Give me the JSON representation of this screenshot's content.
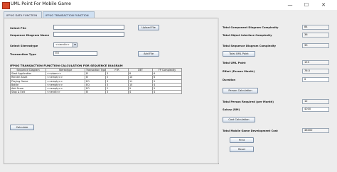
{
  "window": {
    "title": "UML Point For Mobile Game",
    "minimize": "—",
    "maximize": "☐",
    "close": "✕"
  },
  "tabs": [
    {
      "label": "IFPUG DATA FUNCTION"
    },
    {
      "label": "IFPUG TRANSACTION FUNCTION"
    }
  ],
  "form": {
    "select_file_label": "Select File",
    "select_file_value": "",
    "upload_file_label": "Upload File",
    "sequence_diagram_name_label": "Sequence Diagram Name",
    "sequence_diagram_name_value": "",
    "stereotype_label": "Select Stereotype",
    "stereotype_value": "<<endi>>",
    "transaction_type_label": "Transaction Type",
    "transaction_type_value": "EO",
    "add_file_label": "Add File"
  },
  "table": {
    "heading": "IFPUG TRANSACTION FUNCTION CALCULATION FOR SEQUENCE DIAGRAM",
    "columns": [
      "Sequence Diagram",
      "Stereotype",
      "Transaction Type",
      "FTR",
      "DET",
      "FP Complexity"
    ],
    "rows": [
      [
        "Start Application",
        "<<vtam>>",
        "EI",
        "3",
        "8",
        "6"
      ],
      [
        "Render Asset",
        "<<empty>>",
        "EI",
        "5",
        "10",
        "6"
      ],
      [
        "Playing Game",
        "<<empty>>",
        "EO",
        "3",
        "11",
        "5"
      ],
      [
        "Battle",
        "<<empty>>",
        "EQ",
        "3",
        "15",
        "4"
      ],
      [
        "Add Score",
        "<<empty>>",
        "EO",
        "2",
        "9",
        "5"
      ],
      [
        "Stop & Exit",
        "<<endi>>",
        "EI",
        "3",
        "4",
        "4"
      ]
    ]
  },
  "calculate_label": "Calculate",
  "summary": {
    "total_component_label": "Total Component Diagram Complexity",
    "total_component_value": "84",
    "total_object_label": "Total Object Interface Complexity",
    "total_object_value": "36",
    "total_sequence_label": "Total Sequence Diagram Complexity",
    "total_sequence_value": "33",
    "total_uml_button": "Total UML Point",
    "total_uml_label": "Total UML Point",
    "total_uml_value": "153",
    "effort_label": "Effort (Person Month)",
    "effort_value": "76.5",
    "duration_label": "Duration",
    "duration_value": "6",
    "person_calc_button": "Person Calculation",
    "total_person_label": "Total Person Required (per Month)",
    "total_person_value": "12",
    "salary_label": "Salary (RM)",
    "salary_value": "4000",
    "cost_calc_button": "Cost Calculation",
    "total_cost_label": "Total Mobile Game Development Cost",
    "total_cost_value": "48000",
    "print_button": "Print",
    "reset_button": "Reset"
  }
}
